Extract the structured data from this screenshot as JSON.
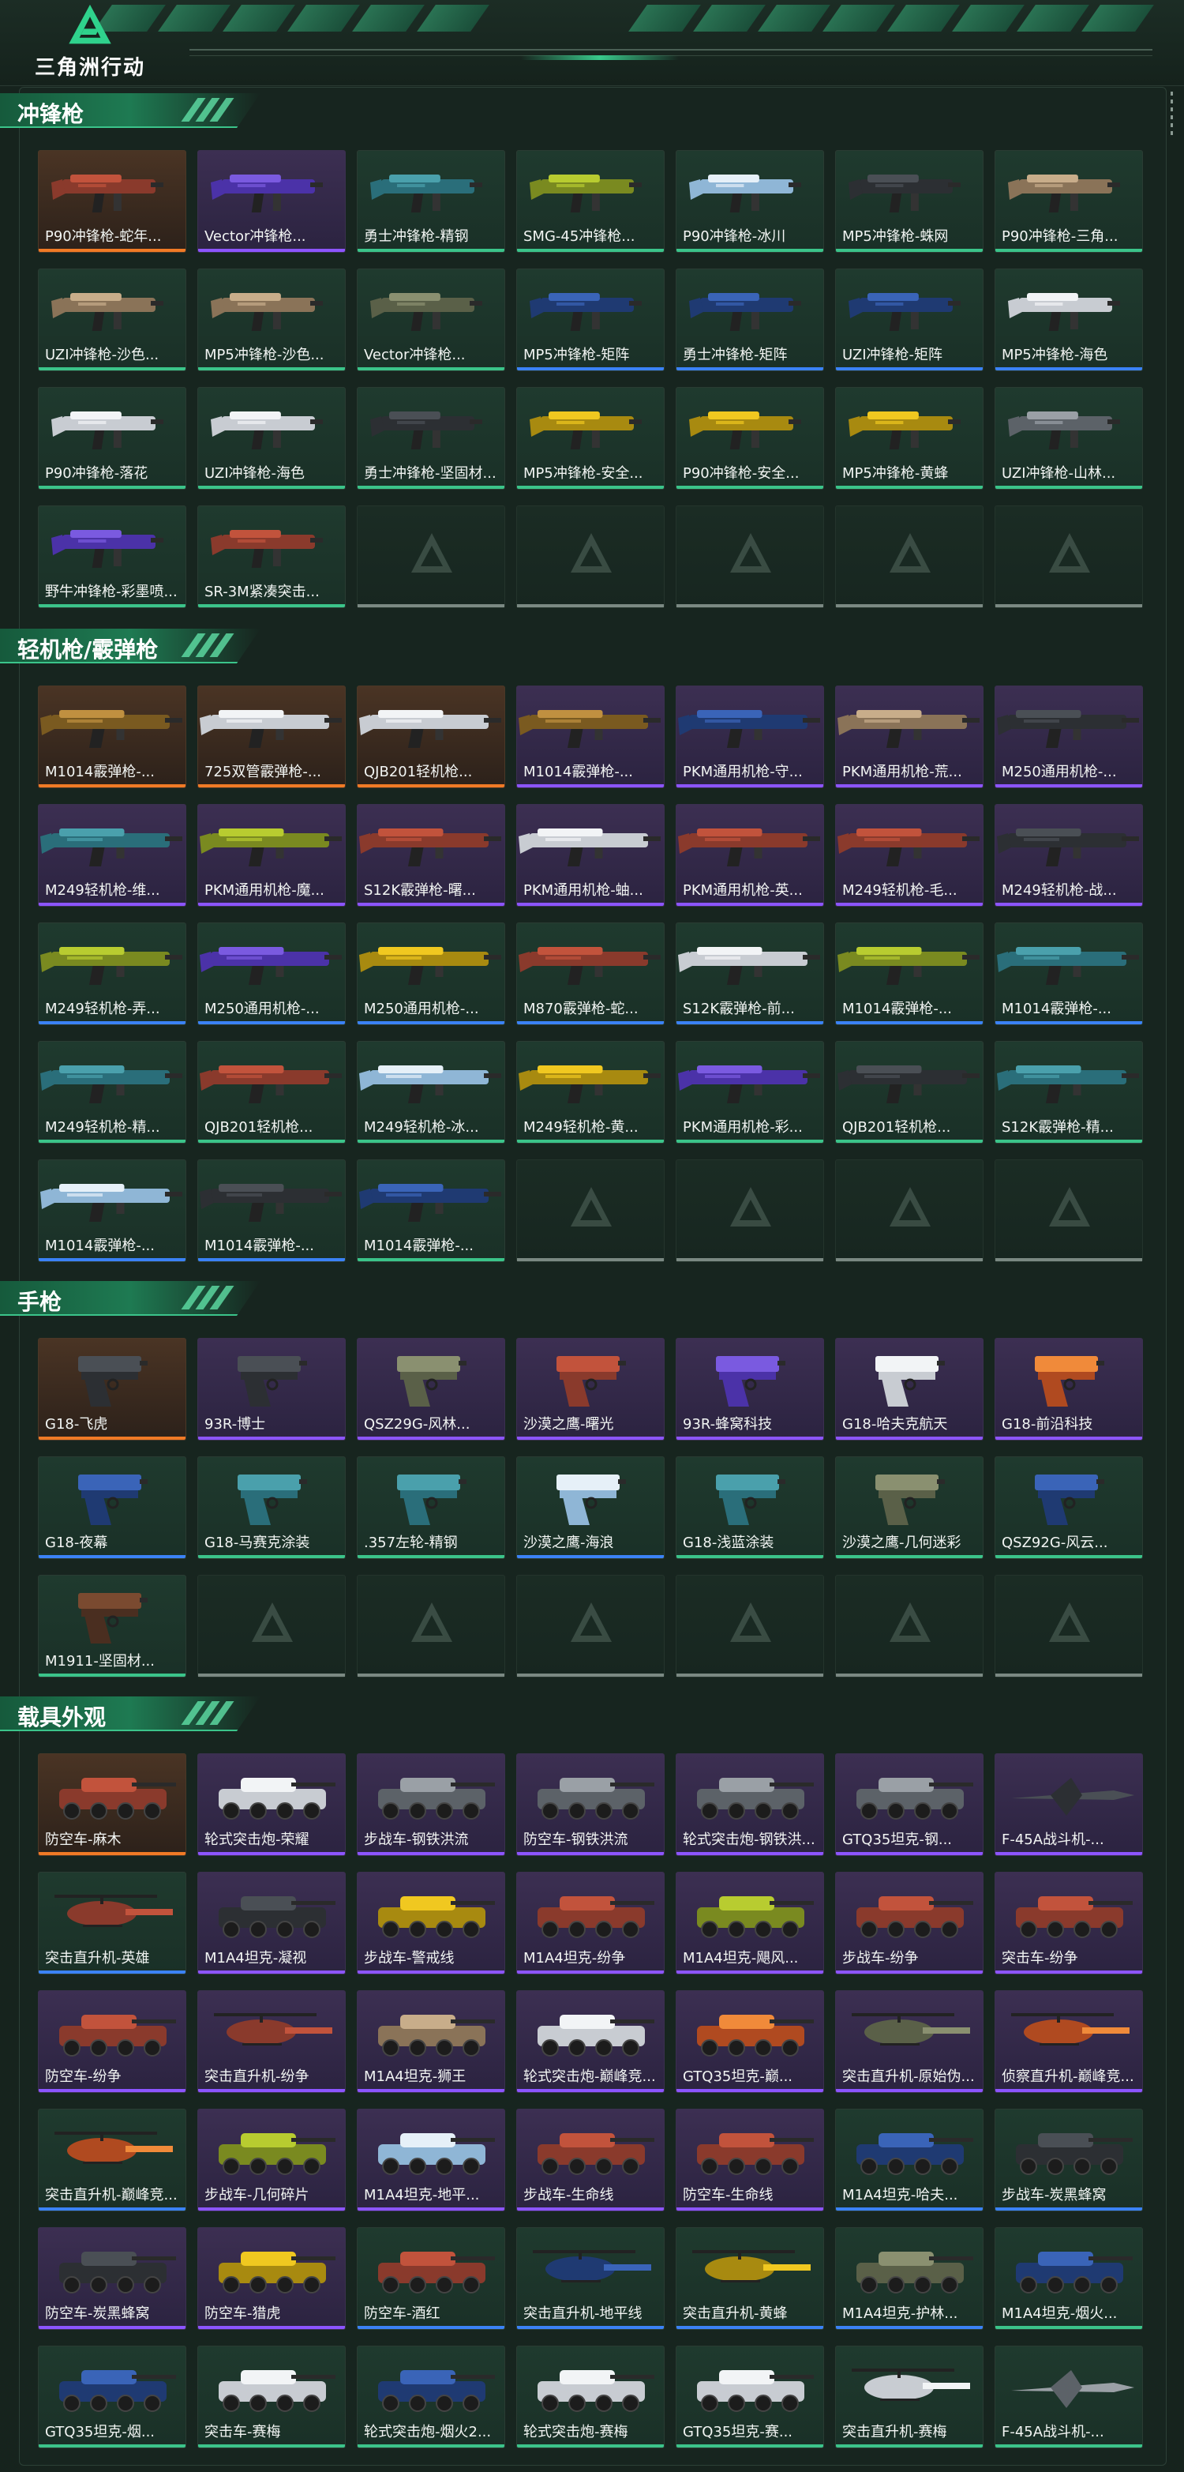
{
  "header": {
    "logo_text": "三角洲行动",
    "logo_icon": "delta-logo-icon"
  },
  "colors": {
    "green": "#3bc48a",
    "purple": "#8c55ff",
    "blue": "#3b82f6",
    "orange": "#f07a26"
  },
  "sections": [
    {
      "title": "冲锋枪",
      "kind": "smg",
      "empty_slots": 5,
      "items": [
        {
          "name": "P90冲锋枪-蛇年...",
          "rarity": "orange",
          "art": "red"
        },
        {
          "name": "Vector冲锋枪...",
          "rarity": "purple",
          "art": "violet"
        },
        {
          "name": "勇士冲锋枪-精钢",
          "rarity": "green",
          "art": "teal"
        },
        {
          "name": "SMG-45冲锋枪...",
          "rarity": "green",
          "art": "lime"
        },
        {
          "name": "P90冲锋枪-冰川",
          "rarity": "green",
          "art": "ice"
        },
        {
          "name": "MP5冲锋枪-蛛网",
          "rarity": "green",
          "art": "dark"
        },
        {
          "name": "P90冲锋枪-三角...",
          "rarity": "green",
          "art": "tan"
        },
        {
          "name": "UZI冲锋枪-沙色...",
          "rarity": "green",
          "art": "tan"
        },
        {
          "name": "MP5冲锋枪-沙色...",
          "rarity": "green",
          "art": "tan"
        },
        {
          "name": "Vector冲锋枪...",
          "rarity": "green",
          "art": "camo"
        },
        {
          "name": "MP5冲锋枪-矩阵",
          "rarity": "blue",
          "art": "navy"
        },
        {
          "name": "勇士冲锋枪-矩阵",
          "rarity": "blue",
          "art": "navy"
        },
        {
          "name": "UZI冲锋枪-矩阵",
          "rarity": "blue",
          "art": "navy"
        },
        {
          "name": "MP5冲锋枪-海色",
          "rarity": "blue",
          "art": "white"
        },
        {
          "name": "P90冲锋枪-落花",
          "rarity": "green",
          "art": "white"
        },
        {
          "name": "UZI冲锋枪-海色",
          "rarity": "green",
          "art": "white"
        },
        {
          "name": "勇士冲锋枪-坚固材...",
          "rarity": "green",
          "art": "dark"
        },
        {
          "name": "MP5冲锋枪-安全...",
          "rarity": "green",
          "art": "yellow"
        },
        {
          "name": "P90冲锋枪-安全...",
          "rarity": "green",
          "art": "yellow"
        },
        {
          "name": "MP5冲锋枪-黄蜂",
          "rarity": "green",
          "art": "yellow"
        },
        {
          "name": "UZI冲锋枪-山林...",
          "rarity": "green",
          "art": "grey"
        },
        {
          "name": "野牛冲锋枪-彩墨喷...",
          "rarity": "green",
          "art": "violet"
        },
        {
          "name": "SR-3M紧凑突击...",
          "rarity": "green",
          "art": "red"
        }
      ]
    },
    {
      "title": "轻机枪/霰弹枪",
      "kind": "lmg",
      "empty_slots": 4,
      "items": [
        {
          "name": "M1014霰弹枪-...",
          "rarity": "orange",
          "art": "gold"
        },
        {
          "name": "725双管霰弹枪-...",
          "rarity": "orange",
          "art": "white"
        },
        {
          "name": "QJB201轻机枪...",
          "rarity": "orange",
          "art": "white"
        },
        {
          "name": "M1014霰弹枪-...",
          "rarity": "purple",
          "art": "gold"
        },
        {
          "name": "PKM通用机枪-守...",
          "rarity": "purple",
          "art": "navy"
        },
        {
          "name": "PKM通用机枪-荒...",
          "rarity": "purple",
          "art": "tan"
        },
        {
          "name": "M250通用机枪-...",
          "rarity": "purple",
          "art": "dark"
        },
        {
          "name": "M249轻机枪-维...",
          "rarity": "purple",
          "art": "teal"
        },
        {
          "name": "PKM通用机枪-魔...",
          "rarity": "purple",
          "art": "lime"
        },
        {
          "name": "S12K霰弹枪-曙...",
          "rarity": "purple",
          "art": "red"
        },
        {
          "name": "PKM通用机枪-蚰...",
          "rarity": "purple",
          "art": "white"
        },
        {
          "name": "PKM通用机枪-英...",
          "rarity": "purple",
          "art": "red"
        },
        {
          "name": "M249轻机枪-毛...",
          "rarity": "purple",
          "art": "red"
        },
        {
          "name": "M249轻机枪-战...",
          "rarity": "purple",
          "art": "dark"
        },
        {
          "name": "M249轻机枪-弄...",
          "rarity": "blue",
          "art": "lime"
        },
        {
          "name": "M250通用机枪-...",
          "rarity": "blue",
          "art": "violet"
        },
        {
          "name": "M250通用机枪-...",
          "rarity": "blue",
          "art": "yellow"
        },
        {
          "name": "M870霰弹枪-蛇...",
          "rarity": "blue",
          "art": "red"
        },
        {
          "name": "S12K霰弹枪-前...",
          "rarity": "blue",
          "art": "white"
        },
        {
          "name": "M1014霰弹枪-...",
          "rarity": "blue",
          "art": "lime"
        },
        {
          "name": "M1014霰弹枪-...",
          "rarity": "blue",
          "art": "teal"
        },
        {
          "name": "M249轻机枪-精...",
          "rarity": "green",
          "art": "teal"
        },
        {
          "name": "QJB201轻机枪...",
          "rarity": "green",
          "art": "red"
        },
        {
          "name": "M249轻机枪-冰...",
          "rarity": "green",
          "art": "ice"
        },
        {
          "name": "M249轻机枪-黄...",
          "rarity": "green",
          "art": "yellow"
        },
        {
          "name": "PKM通用机枪-彩...",
          "rarity": "green",
          "art": "violet"
        },
        {
          "name": "QJB201轻机枪...",
          "rarity": "green",
          "art": "dark"
        },
        {
          "name": "S12K霰弹枪-精...",
          "rarity": "green",
          "art": "teal"
        },
        {
          "name": "M1014霰弹枪-...",
          "rarity": "blue",
          "art": "ice"
        },
        {
          "name": "M1014霰弹枪-...",
          "rarity": "blue",
          "art": "dark"
        },
        {
          "name": "M1014霰弹枪-...",
          "rarity": "green",
          "art": "navy"
        }
      ]
    },
    {
      "title": "手枪",
      "kind": "pistol",
      "empty_slots": 6,
      "items": [
        {
          "name": "G18-飞虎",
          "rarity": "orange",
          "art": "dark"
        },
        {
          "name": "93R-博士",
          "rarity": "purple",
          "art": "dark"
        },
        {
          "name": "QSZ29G-风林...",
          "rarity": "purple",
          "art": "camo"
        },
        {
          "name": "沙漠之鹰-曙光",
          "rarity": "purple",
          "art": "red"
        },
        {
          "name": "93R-蜂窝科技",
          "rarity": "purple",
          "art": "violet"
        },
        {
          "name": "G18-哈夫克航天",
          "rarity": "purple",
          "art": "white"
        },
        {
          "name": "G18-前沿科技",
          "rarity": "purple",
          "art": "orange"
        },
        {
          "name": "G18-夜幕",
          "rarity": "blue",
          "art": "navy"
        },
        {
          "name": "G18-马赛克涂装",
          "rarity": "green",
          "art": "teal"
        },
        {
          "name": ".357左轮-精钢",
          "rarity": "green",
          "art": "teal"
        },
        {
          "name": "沙漠之鹰-海浪",
          "rarity": "blue",
          "art": "ice"
        },
        {
          "name": "G18-浅蓝涂装",
          "rarity": "green",
          "art": "teal"
        },
        {
          "name": "沙漠之鹰-几何迷彩",
          "rarity": "green",
          "art": "camo"
        },
        {
          "name": "QSZ92G-风云...",
          "rarity": "green",
          "art": "navy"
        },
        {
          "name": "M1911-坚固材...",
          "rarity": "green",
          "art": "brown"
        }
      ]
    },
    {
      "title": "载具外观",
      "kind": "vehicle",
      "empty_slots": 0,
      "items": [
        {
          "name": "防空车-麻木",
          "rarity": "orange",
          "art": "red"
        },
        {
          "name": "轮式突击炮-荣耀",
          "rarity": "purple",
          "art": "white"
        },
        {
          "name": "步战车-钢铁洪流",
          "rarity": "purple",
          "art": "grey"
        },
        {
          "name": "防空车-钢铁洪流",
          "rarity": "purple",
          "art": "grey"
        },
        {
          "name": "轮式突击炮-钢铁洪...",
          "rarity": "purple",
          "art": "grey"
        },
        {
          "name": "GTQ35坦克-钢...",
          "rarity": "purple",
          "art": "grey"
        },
        {
          "name": "F-45A战斗机-...",
          "rarity": "purple",
          "art": "dark"
        },
        {
          "name": "突击直升机-英雄",
          "rarity": "blue",
          "art": "red"
        },
        {
          "name": "M1A4坦克-凝视",
          "rarity": "purple",
          "art": "dark"
        },
        {
          "name": "步战车-警戒线",
          "rarity": "purple",
          "art": "yellow"
        },
        {
          "name": "M1A4坦克-纷争",
          "rarity": "purple",
          "art": "red"
        },
        {
          "name": "M1A4坦克-飓风...",
          "rarity": "purple",
          "art": "lime"
        },
        {
          "name": "步战车-纷争",
          "rarity": "purple",
          "art": "red"
        },
        {
          "name": "突击车-纷争",
          "rarity": "purple",
          "art": "red"
        },
        {
          "name": "防空车-纷争",
          "rarity": "purple",
          "art": "red"
        },
        {
          "name": "突击直升机-纷争",
          "rarity": "purple",
          "art": "red"
        },
        {
          "name": "M1A4坦克-狮王",
          "rarity": "purple",
          "art": "tan"
        },
        {
          "name": "轮式突击炮-巅峰竞...",
          "rarity": "purple",
          "art": "white"
        },
        {
          "name": "GTQ35坦克-巅...",
          "rarity": "purple",
          "art": "orange"
        },
        {
          "name": "突击直升机-原始伪...",
          "rarity": "purple",
          "art": "camo"
        },
        {
          "name": "侦察直升机-巅峰竞...",
          "rarity": "purple",
          "art": "orange"
        },
        {
          "name": "突击直升机-巅峰竞...",
          "rarity": "blue",
          "art": "orange"
        },
        {
          "name": "步战车-几何碎片",
          "rarity": "purple",
          "art": "lime"
        },
        {
          "name": "M1A4坦克-地平...",
          "rarity": "purple",
          "art": "ice"
        },
        {
          "name": "步战车-生命线",
          "rarity": "purple",
          "art": "red"
        },
        {
          "name": "防空车-生命线",
          "rarity": "purple",
          "art": "red"
        },
        {
          "name": "M1A4坦克-哈夫...",
          "rarity": "blue",
          "art": "navy"
        },
        {
          "name": "步战车-炭黑蜂窝",
          "rarity": "blue",
          "art": "dark"
        },
        {
          "name": "防空车-炭黑蜂窝",
          "rarity": "purple",
          "art": "dark"
        },
        {
          "name": "防空车-猎虎",
          "rarity": "purple",
          "art": "yellow"
        },
        {
          "name": "防空车-酒红",
          "rarity": "blue",
          "art": "red"
        },
        {
          "name": "突击直升机-地平线",
          "rarity": "blue",
          "art": "navy"
        },
        {
          "name": "突击直升机-黄蜂",
          "rarity": "blue",
          "art": "yellow"
        },
        {
          "name": "M1A4坦克-护林...",
          "rarity": "blue",
          "art": "camo"
        },
        {
          "name": "M1A4坦克-烟火...",
          "rarity": "green",
          "art": "navy"
        },
        {
          "name": "GTQ35坦克-烟...",
          "rarity": "green",
          "art": "navy"
        },
        {
          "name": "突击车-赛梅",
          "rarity": "green",
          "art": "white"
        },
        {
          "name": "轮式突击炮-烟火2...",
          "rarity": "green",
          "art": "navy"
        },
        {
          "name": "轮式突击炮-赛梅",
          "rarity": "green",
          "art": "white"
        },
        {
          "name": "GTQ35坦克-赛...",
          "rarity": "green",
          "art": "white"
        },
        {
          "name": "突击直升机-赛梅",
          "rarity": "green",
          "art": "white"
        },
        {
          "name": "F-45A战斗机-...",
          "rarity": "green",
          "art": "grey"
        }
      ]
    }
  ]
}
